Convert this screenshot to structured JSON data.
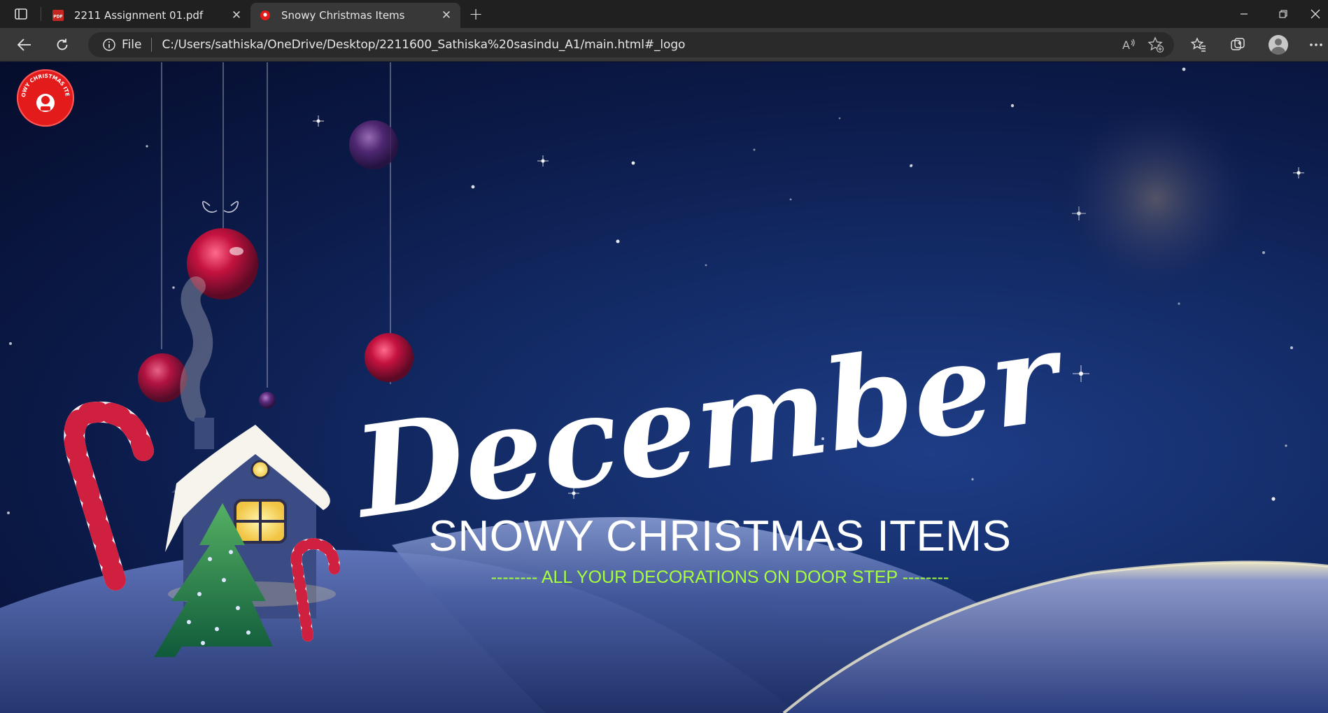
{
  "browser": {
    "tabs": [
      {
        "title": "2211 Assignment 01.pdf",
        "icon": "pdf-icon",
        "active": false
      },
      {
        "title": "Snowy Christmas Items",
        "icon": "site-favicon",
        "active": true
      }
    ],
    "pdf_icon_text": "PDF",
    "address": {
      "scheme": "File",
      "url": "C:/Users/sathiska/OneDrive/Desktop/2211600_Sathiska%20sasindu_A1/main.html#_logo"
    }
  },
  "page": {
    "logo_text": "SNOWY CHRISTMAS ITEMS",
    "script_word": "December",
    "headline": "SNOWY CHRISTMAS ITEMS",
    "tagline": "-------- ALL YOUR DECORATIONS ON DOOR STEP --------"
  },
  "colors": {
    "tagline": "#a6ff3a",
    "logo": "#e41b1b",
    "ornament": "#b0103a",
    "moon": "#fff6c8"
  }
}
